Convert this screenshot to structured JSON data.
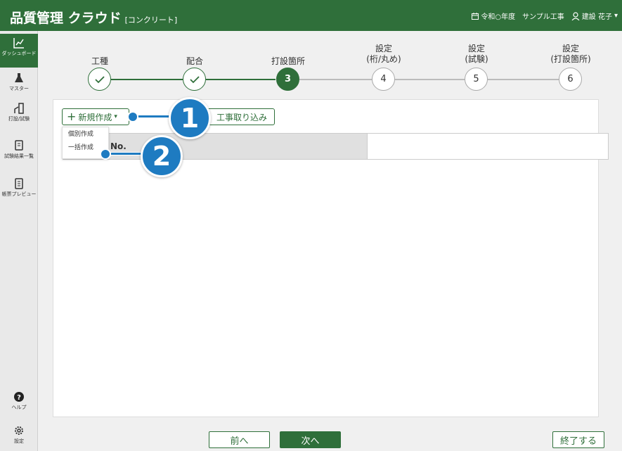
{
  "header": {
    "app_title": "品質管理 クラウド",
    "app_subtitle": "[コンクリート]",
    "fiscal_year": "令和○年度",
    "project": "サンプル工事",
    "user": "建設 花子"
  },
  "sidebar": {
    "items": [
      {
        "label": "ダッシュボード",
        "icon": "dashboard-icon",
        "active": true
      },
      {
        "label": "マスター",
        "icon": "flask-icon"
      },
      {
        "label": "打設/試験",
        "icon": "pouring-icon"
      },
      {
        "label": "試験結果一覧",
        "icon": "results-icon"
      },
      {
        "label": "帳票プレビュー",
        "icon": "report-icon"
      }
    ],
    "help_label": "ヘルプ",
    "settings_label": "設定"
  },
  "steps": [
    {
      "label": "工種",
      "state": "done"
    },
    {
      "label": "配合",
      "state": "done"
    },
    {
      "label": "打設箇所",
      "number": "3",
      "state": "current"
    },
    {
      "label": "設定\n(桁/丸め)",
      "number": "4",
      "state": "todo"
    },
    {
      "label": "設定\n(試験)",
      "number": "5",
      "state": "todo"
    },
    {
      "label": "設定\n(打設箇所)",
      "number": "6",
      "state": "todo"
    }
  ],
  "toolbar": {
    "new_label": "新規作成",
    "import_label": "工事取り込み"
  },
  "dropdown": {
    "items": [
      "個別作成",
      "一括作成"
    ]
  },
  "table": {
    "header": "No."
  },
  "callouts": [
    "1",
    "2"
  ],
  "footer": {
    "prev": "前へ",
    "next": "次へ",
    "finish": "終了する"
  },
  "colors": {
    "brand": "#2f6f3a",
    "callout": "#1e7bc1"
  }
}
